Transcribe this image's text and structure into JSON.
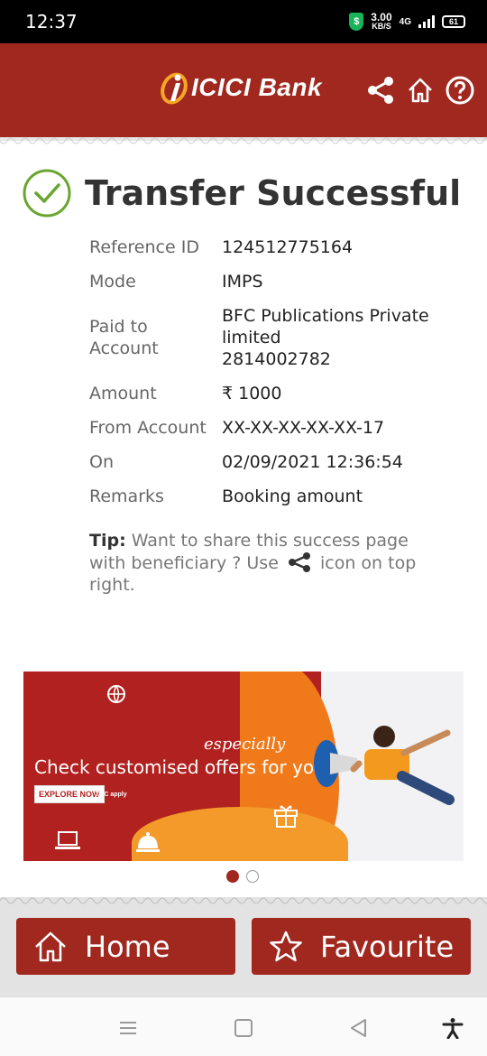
{
  "status_bar": {
    "time": "12:37",
    "speed_value": "3.00",
    "speed_unit": "KB/S",
    "network": "4G",
    "battery": "61"
  },
  "header": {
    "brand": "ICICI",
    "brand_suffix": "Bank"
  },
  "page": {
    "title": "Transfer Successful"
  },
  "details": [
    {
      "label": "Reference ID",
      "value": "124512775164"
    },
    {
      "label": "Mode",
      "value": "IMPS"
    },
    {
      "label": "Paid to Account",
      "value": "BFC Publications Private limited",
      "value2": "2814002782"
    },
    {
      "label": "Amount",
      "value": "₹ 1000"
    },
    {
      "label": "From Account",
      "value": "XX-XX-XX-XX-XX-17"
    },
    {
      "label": "On",
      "value": "02/09/2021 12:36:54"
    },
    {
      "label": "Remarks",
      "value": "Booking amount"
    }
  ],
  "tip": {
    "label": "Tip:",
    "text_before": "Want to share this success page with beneficiary ? Use",
    "text_after": "icon on top right."
  },
  "banner": {
    "headline": "Check customised offers for you!",
    "script_word": "especially",
    "cta": "EXPLORE NOW",
    "terms": "T&C apply"
  },
  "carousel": {
    "active_index": 0,
    "count": 2
  },
  "buttons": {
    "home": "Home",
    "favourite": "Favourite"
  },
  "colors": {
    "primary": "#a0281f",
    "success": "#6aa52e",
    "banner_red": "#b1211f",
    "banner_orange": "#f07a1a"
  }
}
